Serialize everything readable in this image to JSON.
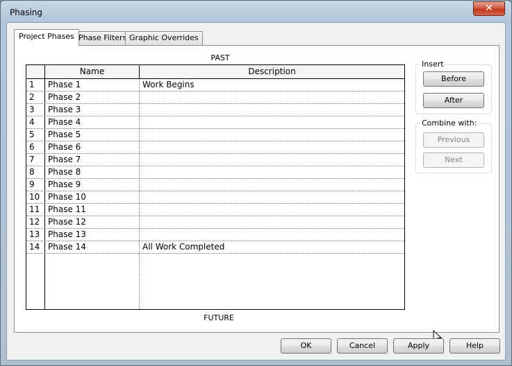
{
  "window": {
    "title": "Phasing",
    "close_symbol": "✕"
  },
  "tabs": [
    {
      "label": "Project Phases"
    },
    {
      "label": "Phase Filters"
    },
    {
      "label": "Graphic Overrides"
    }
  ],
  "grid": {
    "top_label": "PAST",
    "bottom_label": "FUTURE",
    "columns": [
      "Name",
      "Description"
    ],
    "rows": [
      {
        "num": "1",
        "name": "Phase 1",
        "description": "Work Begins"
      },
      {
        "num": "2",
        "name": "Phase 2",
        "description": ""
      },
      {
        "num": "3",
        "name": "Phase 3",
        "description": ""
      },
      {
        "num": "4",
        "name": "Phase 4",
        "description": ""
      },
      {
        "num": "5",
        "name": "Phase 5",
        "description": ""
      },
      {
        "num": "6",
        "name": "Phase 6",
        "description": ""
      },
      {
        "num": "7",
        "name": "Phase 7",
        "description": ""
      },
      {
        "num": "8",
        "name": "Phase 8",
        "description": ""
      },
      {
        "num": "9",
        "name": "Phase 9",
        "description": ""
      },
      {
        "num": "10",
        "name": "Phase 10",
        "description": ""
      },
      {
        "num": "11",
        "name": "Phase 11",
        "description": ""
      },
      {
        "num": "12",
        "name": "Phase 12",
        "description": ""
      },
      {
        "num": "13",
        "name": "Phase 13",
        "description": ""
      },
      {
        "num": "14",
        "name": "Phase 14",
        "description": "All Work Completed"
      }
    ]
  },
  "insert_group": {
    "title": "Insert",
    "before_label": "Before",
    "after_label": "After"
  },
  "combine_group": {
    "title": "Combine with:",
    "previous_label": "Previous",
    "next_label": "Next"
  },
  "footer": {
    "ok_label": "OK",
    "cancel_label": "Cancel",
    "apply_label": "Apply",
    "help_label": "Help"
  }
}
